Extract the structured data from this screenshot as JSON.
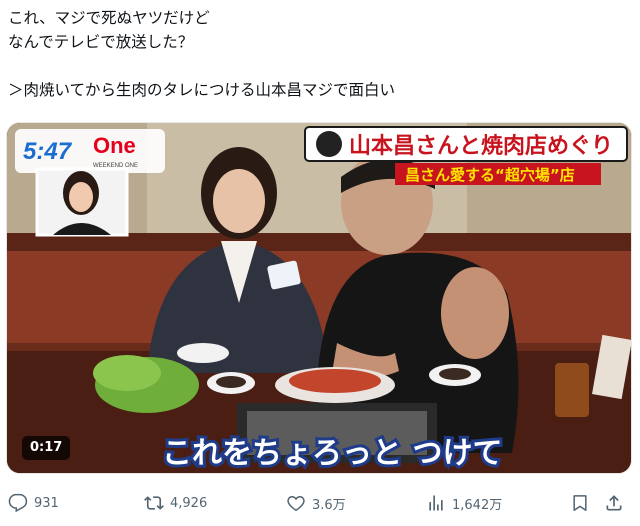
{
  "post": {
    "lines": [
      "これ、マジで死ぬヤツだけど",
      "なんでテレビで放送した？",
      "",
      "＞肉焼いてから生肉のタレにつける山本昌マジで面白い"
    ]
  },
  "video": {
    "program_time": "5:47",
    "program_logo": "One",
    "program_logo_sub": "WEEKEND ONE",
    "title_banner": "山本昌さんと焼肉店めぐり",
    "subtitle_banner": "昌さん愛する“超穴場”店",
    "caption": "これをちょろっと つけて",
    "duration": "0:17"
  },
  "actions": {
    "reply_icon": "reply-icon",
    "replies": "931",
    "repost_icon": "repost-icon",
    "reposts": "4,926",
    "like_icon": "heart-icon",
    "likes": "3.6万",
    "views_icon": "bar-chart-icon",
    "views": "1,642万",
    "bookmark_icon": "bookmark-icon",
    "share_icon": "share-icon"
  },
  "colors": {
    "action_gray": "#536471",
    "banner_red": "#c8141e",
    "banner_yellow": "#ffe400",
    "caption_fill": "#ffffff",
    "caption_stroke": "#1f3c8a"
  }
}
